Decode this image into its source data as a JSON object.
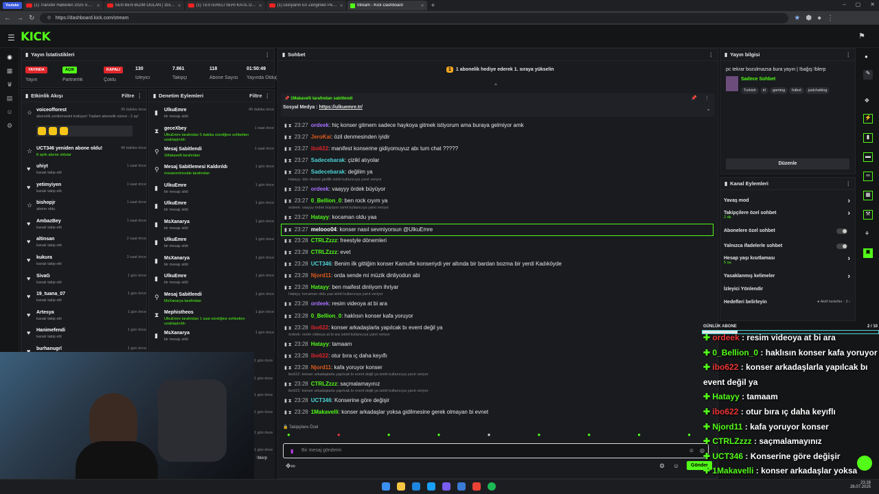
{
  "browser": {
    "tabs": [
      "(1) Transfer Haberleri 2025 S.E.S.F",
      "SEN BEN BİZİM OĞLAN | 3Gider",
      "(1) TESTERELİ SERİ KATİL DOSYA",
      "(1) Dünyanın En Zenginleri Peşin",
      "Stream - Kick Dashboard"
    ],
    "youtube_badge": "Youtube",
    "url": "https://dashboard.kick.com/stream",
    "time": "23:28",
    "date": "28.07.2025"
  },
  "logo": "KICK",
  "stats": {
    "title": "Yayın İstatistikleri",
    "items": [
      {
        "badge": "YAYINDA",
        "label": "Yayın",
        "color": "#e0262b"
      },
      {
        "badge": "AÇIK",
        "label": "Partnerlik",
        "color": "#53fc18"
      },
      {
        "badge": "KAPALI",
        "label": "Çoklu",
        "color": "#e0262b"
      },
      {
        "value": "130",
        "label": "İzleyici"
      },
      {
        "value": "7.861",
        "label": "Takipçi"
      },
      {
        "value": "118",
        "label": "Abone Sayısı"
      },
      {
        "value": "01:50:49",
        "label": "Yayında Olduğu"
      }
    ]
  },
  "activity": {
    "title": "Etkinlik Akışı",
    "filter": "Filtre",
    "items": [
      {
        "name": "voiceofforest",
        "sub": "abonelik yenilemesini kutluyor! Toplam abonelik süresi - 2 ay!",
        "time": "30 dakika önce",
        "icon": "☆"
      },
      {
        "name": "UCT346 yeniden abone oldu!",
        "sub": "8 aylık abone oldular",
        "time": "49 dakika önce",
        "icon": "☆"
      },
      {
        "name": "uhiyt",
        "sub": "kanalı takip etti",
        "time": "1 saat önce",
        "icon": "♥"
      },
      {
        "name": "yetimyiyen",
        "sub": "kanalı takip etti",
        "time": "1 saat önce",
        "icon": "♥"
      },
      {
        "name": "bishopjr",
        "sub": "abone oldu",
        "time": "1 saat önce",
        "icon": "☆"
      },
      {
        "name": "AmbazBey",
        "sub": "kanalı takip etti",
        "time": "1 saat önce",
        "icon": "♥"
      },
      {
        "name": "altinsan",
        "sub": "kanalı takip etti",
        "time": "2 saat önce",
        "icon": "♥"
      },
      {
        "name": "kukura",
        "sub": "kanalı takip etti",
        "time": "3 saat önce",
        "icon": "♥"
      },
      {
        "name": "SivaG",
        "sub": "kanalı takip etti",
        "time": "1 gün önce",
        "icon": "♥"
      },
      {
        "name": "19_tuana_07",
        "sub": "kanalı takip etti",
        "time": "1 gün önce",
        "icon": "♥"
      },
      {
        "name": "Artesya",
        "sub": "kanalı takip etti",
        "time": "1 gün önce",
        "icon": "♥"
      },
      {
        "name": "Hanimefendi",
        "sub": "kanalı takip etti",
        "time": "1 gün önce",
        "icon": "♥"
      },
      {
        "name": "burhanugrl",
        "sub": "",
        "time": "1 gün önce",
        "icon": "♥"
      }
    ]
  },
  "moderation": {
    "title": "Denetim Eylemleri",
    "filter": "Filtre",
    "items": [
      {
        "name": "UlkuEmre",
        "sub": "bir mesajı sildi",
        "time": "40 dakika önce",
        "icon": "🗑"
      },
      {
        "name": "geceXbey",
        "sub": "UlkuEmre tarafından 5 dakika süreliğine sohbetten uzaklaştırıldı",
        "time": "1 saat önce",
        "icon": "⧗"
      },
      {
        "name": "Mesaj Sabitlendi",
        "sub": "1Makavelli tarafından",
        "time": "1 saat önce",
        "icon": "📌"
      },
      {
        "name": "Mesaj Sabitlemesi Kaldırıldı",
        "sub": "msxanontrioxide tarafından",
        "time": "1 gün önce",
        "icon": "📌"
      },
      {
        "name": "UlkuEmre",
        "sub": "bir mesajı sildi",
        "time": "1 gün önce",
        "icon": "🗑"
      },
      {
        "name": "UlkuEmre",
        "sub": "bir mesajı sildi",
        "time": "1 gün önce",
        "icon": "🗑"
      },
      {
        "name": "MsXanarya",
        "sub": "bir mesajı sildi",
        "time": "1 gün önce",
        "icon": "🗑"
      },
      {
        "name": "UlkuEmre",
        "sub": "bir mesajı sildi",
        "time": "1 gün önce",
        "icon": "🗑"
      },
      {
        "name": "MsXanarya",
        "sub": "bir mesajı sildi",
        "time": "1 gün önce",
        "icon": "🗑"
      },
      {
        "name": "UlkuEmre",
        "sub": "bir mesajı sildi",
        "time": "1 gün önce",
        "icon": "🗑"
      },
      {
        "name": "Mesaj Sabitlendi",
        "sub": "MsXanarya tarafından",
        "time": "1 gün önce",
        "icon": "📌"
      },
      {
        "name": "Mephistheos",
        "sub": "UlkuEmre tarafından 1 saat süreliğine sohbetten uzaklaştırıldı",
        "time": "1 gün önce",
        "icon": "⧗"
      },
      {
        "name": "MsXanarya",
        "sub": "bir mesajı sildi",
        "time": "1 gün önce",
        "icon": "🗑"
      }
    ]
  },
  "chat": {
    "title": "Sohbet",
    "goal": "1 abonelik hediye ederek 1. sıraya yükselin",
    "pinned_by": "1Makavelli tarafından sabitlendi",
    "pinned_text": "Sosyal Medya : ",
    "pinned_link": "https://ulkuemre.tr/",
    "input_placeholder": "Bir mesaj gönderin",
    "send": "Gönder",
    "followers_only": "Takipçilere Özel",
    "messages": [
      {
        "time": "23:27",
        "user": "ordeek",
        "color": "#a970ff",
        "text": "hiç konser gitmem sadece haykoya gitmek istiyorum ama buraya gelmiyor amk"
      },
      {
        "time": "23:27",
        "user": "JeroKai",
        "color": "#e05a1b",
        "text": "özil denmesinden iyidir"
      },
      {
        "time": "23:27",
        "user": "ibo622",
        "color": "#e0262b",
        "text": "manifest konserine gidiyomuyuz abı tum chat ?????"
      },
      {
        "time": "23:27",
        "user": "Sadecebarak",
        "color": "#4cd3d3",
        "text": "çizikl atıyolar"
      },
      {
        "time": "23:27",
        "user": "Sadecebarak",
        "color": "#4cd3d3",
        "text": "değilim ya"
      },
      {
        "reply": "Hatayy: dün denize girdilk isimli kullanıcıya yanıt veriyor"
      },
      {
        "time": "23:27",
        "user": "ordeek",
        "color": "#a970ff",
        "text": "vaayyy ördek büyüyor"
      },
      {
        "time": "23:27",
        "user": "0_Bellion_0",
        "color": "#53fc18",
        "text": "ben rock cıyım ya"
      },
      {
        "reply": "ordeek: vaayyy ördek büyüyor isimli kullanıcıya yanıt veriyor"
      },
      {
        "time": "23:27",
        "user": "Hatayy",
        "color": "#53fc18",
        "text": "kocaman oldu yaa"
      },
      {
        "time": "23:27",
        "user": "melooo04",
        "color": "#ffffff",
        "text": "konser nasıl sevmiyorsun @UlkuEmre",
        "highlight": true
      },
      {
        "time": "23:28",
        "user": "CTRLZzzz",
        "color": "#53fc18",
        "text": "freestyle dönemleri"
      },
      {
        "time": "23:28",
        "user": "CTRLZzzz",
        "color": "#53fc18",
        "text": "evet"
      },
      {
        "time": "23:28",
        "user": "UCT346",
        "color": "#4cd3d3",
        "text": "Benim ilk gittiğim konser Kamufle konseriydi yer altında bir bardan bozma bir yerdi Kadıköyde"
      },
      {
        "time": "23:28",
        "user": "Njord11",
        "color": "#e05a1b",
        "text": "orda sende mi müzik dinliyodun abi"
      },
      {
        "time": "23:28",
        "user": "Hatayy",
        "color": "#53fc18",
        "text": "ben maifest dinliyom ihriyar"
      },
      {
        "reply": "Hatayy: kocaman oldu yaa isimli kullanıcıya yanıt veriyor"
      },
      {
        "time": "23:28",
        "user": "ordeek",
        "color": "#a970ff",
        "text": "resim videoya at bi ara"
      },
      {
        "time": "23:28",
        "user": "0_Bellion_0",
        "color": "#53fc18",
        "text": "haklısın konser kafa yoruyor"
      },
      {
        "time": "23:28",
        "user": "ibo622",
        "color": "#e0262b",
        "text": "konser arkadaşlarla yapılcak bı event değil ya"
      },
      {
        "reply": "ordeek: resim videoya at bi ara isimli kullanıcıya yanıt veriyor"
      },
      {
        "time": "23:28",
        "user": "Hatayy",
        "color": "#53fc18",
        "text": "tamaam"
      },
      {
        "time": "23:28",
        "user": "ibo622",
        "color": "#e0262b",
        "text": "otur bıra ıç daha keyıflı"
      },
      {
        "time": "23:28",
        "user": "Njord11",
        "color": "#e05a1b",
        "text": "kafa yoruyor konser"
      },
      {
        "reply": "ibo622: konser arkadaşlarla yapılcak bı event değil ya isimli kullanıcıya yanıt veriyor"
      },
      {
        "time": "23:28",
        "user": "CTRLZzzz",
        "color": "#53fc18",
        "text": "saçmalamayınız"
      },
      {
        "reply": "ibo622: konser arkadaşlarla yapılcak bı event değil ya isimli kullanıcıya yanıt veriyor"
      },
      {
        "time": "23:28",
        "user": "UCT346",
        "color": "#4cd3d3",
        "text": "Konserine göre değişir"
      },
      {
        "time": "23:28",
        "user": "1Makavelli",
        "color": "#53fc18",
        "text": "konser arkadaşlar yoksa gidilmesine gerek olmayan bi evnet"
      }
    ]
  },
  "streaminfo": {
    "title": "Yayın bilgisi",
    "stream_title": "pc tekrar bozulmazsa bura yayın | !bağış !blerp",
    "category": "Sadece Sohbet",
    "tags": [
      "Turkish",
      "irl",
      "gaming",
      "futbol",
      "justchatting"
    ],
    "edit": "Düzenle"
  },
  "channel": {
    "title": "Kanal Eylemleri",
    "items": [
      {
        "label": "Yavaş mod",
        "sub": "",
        "ctl": "arrow"
      },
      {
        "label": "Takipçilere özel sohbet",
        "sub": "2 dk.",
        "ctl": "arrow"
      },
      {
        "label": "Abonelere özel sohbet",
        "sub": "",
        "ctl": "toggle"
      },
      {
        "label": "Yalnızca ifadelerle sohbet",
        "sub": "",
        "ctl": "toggle"
      },
      {
        "label": "Hesap yaşı kısıtlaması",
        "sub": "5 sa.",
        "ctl": "arrow"
      },
      {
        "label": "Yasaklanmış kelimeler",
        "sub": "",
        "ctl": "arrow"
      },
      {
        "label": "İzleyici Yönlendir",
        "sub": "",
        "ctl": "none"
      },
      {
        "label": "Hedefleri belirleyin",
        "sub": "",
        "ctl": "goal",
        "extra": "Aktif hedefler - 2"
      }
    ]
  },
  "overlay": {
    "goal_label": "GÜNLÜK ABONE",
    "goal_count": "2 / 10",
    "goal_progress": 0.2,
    "lines": [
      {
        "user": "ordeek",
        "text": " : resim videoya at bi ara",
        "ucolor": "#e33"
      },
      {
        "user": "0_Bellion_0",
        "text": " : haklısın konser kafa yoruyor",
        "ucolor": "#53fc18"
      },
      {
        "user": "ibo622",
        "text": " : konser arkadaşlarla yapılcak bı",
        "ucolor": "#e33"
      },
      {
        "user": "",
        "text": "event değil ya",
        "ucolor": "#fff"
      },
      {
        "user": "Hatayy",
        "text": " : tamaam",
        "ucolor": "#53fc18"
      },
      {
        "user": "ibo622",
        "text": " : otur bıra ıç daha keyıflı",
        "ucolor": "#e33"
      },
      {
        "user": "Njord11",
        "text": " : kafa yoruyor konser",
        "ucolor": "#53fc18"
      },
      {
        "user": "CTRLZzzz",
        "text": " : saçmalamayınız",
        "ucolor": "#53fc18"
      },
      {
        "user": "UCT346",
        "text": " : Konserine göre değişir",
        "ucolor": "#53fc18"
      },
      {
        "user": "1Makavelli",
        "text": " : konser arkadaşlar yoksa",
        "ucolor": "#53fc18"
      },
      {
        "user": "",
        "text": "gidilmesine gerek olmayan bi evnet",
        "ucolor": "#fff"
      }
    ]
  },
  "side_under": {
    "uzaklastirildi": "uzaklaştırıldı",
    "blerp": "!blerp"
  }
}
